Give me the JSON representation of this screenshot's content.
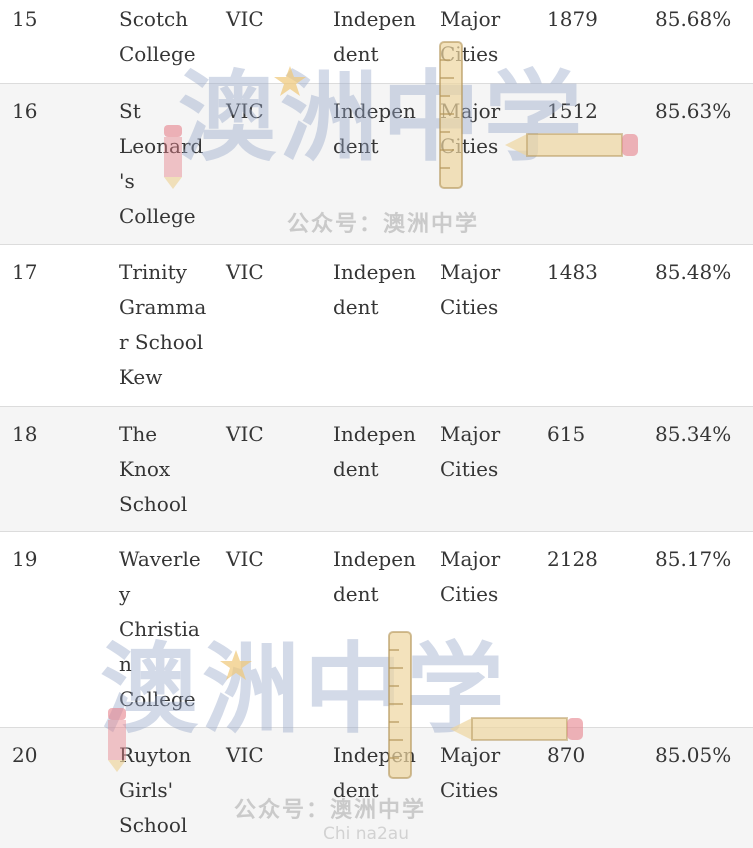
{
  "rows": [
    {
      "rank": "15",
      "name": "Scotch\nCollege",
      "state": "VIC",
      "sector": "Indepen\ndent",
      "area": "Major\nCities",
      "enrolment": "1879",
      "score": "85.68%"
    },
    {
      "rank": "16",
      "name": "St\nLeonard\n's\nCollege",
      "state": "VIC",
      "sector": "Indepen\ndent",
      "area": "Major\nCities",
      "enrolment": "1512",
      "score": "85.63%"
    },
    {
      "rank": "17",
      "name": "Trinity\nGramma\nr School\nKew",
      "state": "VIC",
      "sector": "Indepen\ndent",
      "area": "Major\nCities",
      "enrolment": "1483",
      "score": "85.48%"
    },
    {
      "rank": "18",
      "name": "The\nKnox\nSchool",
      "state": "VIC",
      "sector": "Indepen\ndent",
      "area": "Major\nCities",
      "enrolment": "615",
      "score": "85.34%"
    },
    {
      "rank": "19",
      "name": "Waverle\ny\nChristia\nn\nCollege",
      "state": "VIC",
      "sector": "Indepen\ndent",
      "area": "Major\nCities",
      "enrolment": "2128",
      "score": "85.17%"
    },
    {
      "rank": "20",
      "name": "Ruyton\nGirls'\nSchool",
      "state": "VIC",
      "sector": "Indepen\ndent",
      "area": "Major\nCities",
      "enrolment": "870",
      "score": "85.05%"
    }
  ],
  "watermark": {
    "brand": "澳洲中学",
    "account": "公众号：澳洲中学",
    "account2": "公众号：澳洲中学",
    "site_id": "Chi na2au"
  }
}
